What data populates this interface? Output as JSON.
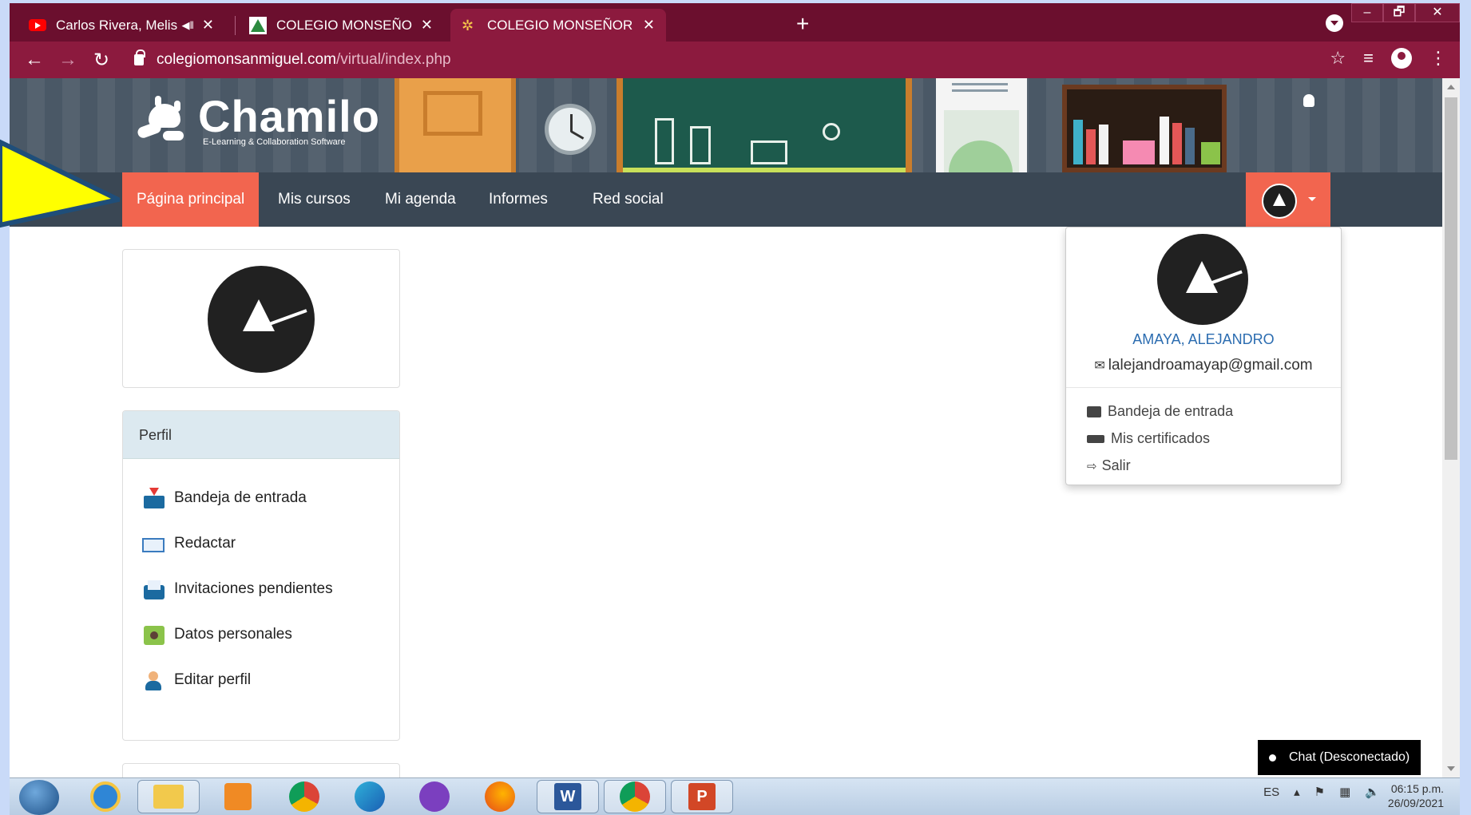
{
  "browser": {
    "tabs": [
      {
        "title": "Carlos Rivera, Melissa Robles",
        "icon": "youtube-icon",
        "audio": true
      },
      {
        "title": "COLEGIO MONSEÑOR SANMIGU",
        "icon": "school-logo-icon"
      },
      {
        "title": "COLEGIO MONSEÑOR SANMIGU",
        "icon": "chamilo-star-icon",
        "active": true
      }
    ],
    "new_tab": "+",
    "window_controls": [
      "–",
      "🗗",
      "✕"
    ],
    "url_host": "colegiomonsanmiguel.com",
    "url_path": "/virtual/index.php"
  },
  "banner": {
    "logo_title": "Chamilo",
    "logo_subtitle": "E-Learning & Collaboration Software"
  },
  "nav": {
    "items": [
      "Página principal",
      "Mis cursos",
      "Mi agenda",
      "Informes",
      "Red social"
    ],
    "active_index": 0
  },
  "sidebar": {
    "profile_panel_title": "Perfil",
    "items": [
      "Bandeja de entrada",
      "Redactar",
      "Invitaciones pendientes",
      "Datos personales",
      "Editar perfil"
    ]
  },
  "user_menu": {
    "name": "AMAYA, ALEJANDRO",
    "email": "lalejandroamayap@gmail.com",
    "items": [
      "Bandeja de entrada",
      "Mis certificados",
      "Salir"
    ]
  },
  "chat": {
    "label": "Chat (Desconectado)"
  },
  "taskbar": {
    "lang": "ES",
    "time": "06:15 p.m.",
    "date": "26/09/2021"
  },
  "colors": {
    "accent": "#f2654f",
    "navbar": "#3a4754",
    "annotation_arrow": "#ffff00"
  }
}
